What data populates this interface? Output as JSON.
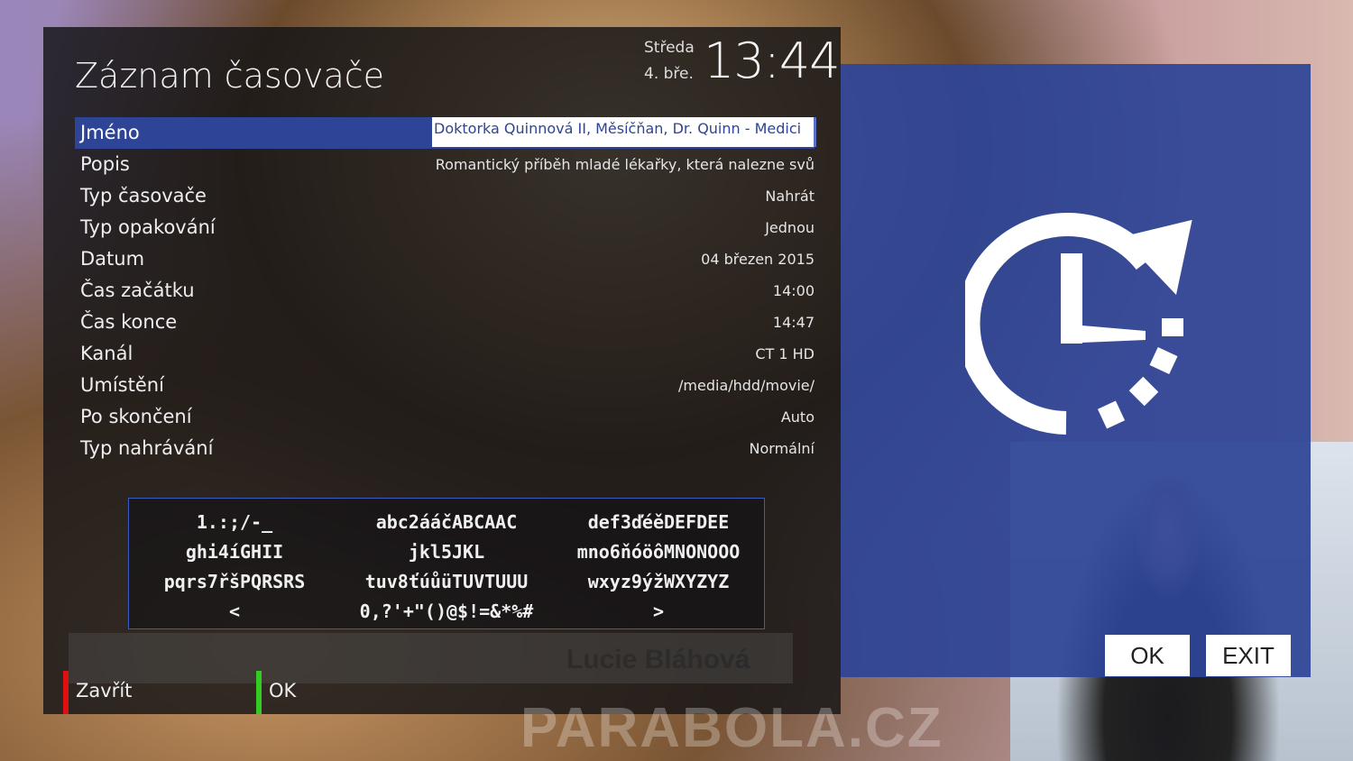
{
  "header": {
    "title": "Záznam časovače",
    "day": "Středa",
    "date": "4. bře.",
    "time": "13:44"
  },
  "fields": [
    {
      "label": "Jméno",
      "value": "Doktorka Quinnová II, Měsíčňan, Dr. Quinn - Medici",
      "selected": true
    },
    {
      "label": "Popis",
      "value": "Romantický příběh mladé lékařky, která nalezne svů"
    },
    {
      "label": "Typ časovače",
      "value": "Nahrát"
    },
    {
      "label": "Typ opakování",
      "value": "Jednou"
    },
    {
      "label": "Datum",
      "value": "04 březen 2015"
    },
    {
      "label": "Čas začátku",
      "value": "14:00"
    },
    {
      "label": "Čas konce",
      "value": "14:47"
    },
    {
      "label": "Kanál",
      "value": "CT 1 HD"
    },
    {
      "label": "Umístění",
      "value": "/media/hdd/movie/"
    },
    {
      "label": "Po skončení",
      "value": "Auto"
    },
    {
      "label": "Typ nahrávání",
      "value": "Normální"
    }
  ],
  "keypad": [
    [
      "1.:;/-_",
      "abc2ááčABCAAC",
      "def3ďéěDEFDEE"
    ],
    [
      "ghi4íGHII",
      "jkl5JKL",
      "mno6ňóöôMNONOOO"
    ],
    [
      "pqrs7řšPQRSRS",
      "tuv8ťúůüTUVTUUU",
      "wxyz9ýžWXYZYZ"
    ],
    [
      "<",
      "0,?'+\"()@$!=&*%#",
      ">"
    ]
  ],
  "buttons": {
    "red_label": "Zavřít",
    "green_label": "OK"
  },
  "side_panel": {
    "ok_label": "OK",
    "exit_label": "EXIT",
    "icon": "timer-clock-icon"
  },
  "background": {
    "ghost_name": "Lucie Bláhová",
    "watermark": "PARABOLA.CZ"
  },
  "colors": {
    "accent": "#2e4597",
    "red": "#e01010",
    "green": "#33cc22"
  }
}
